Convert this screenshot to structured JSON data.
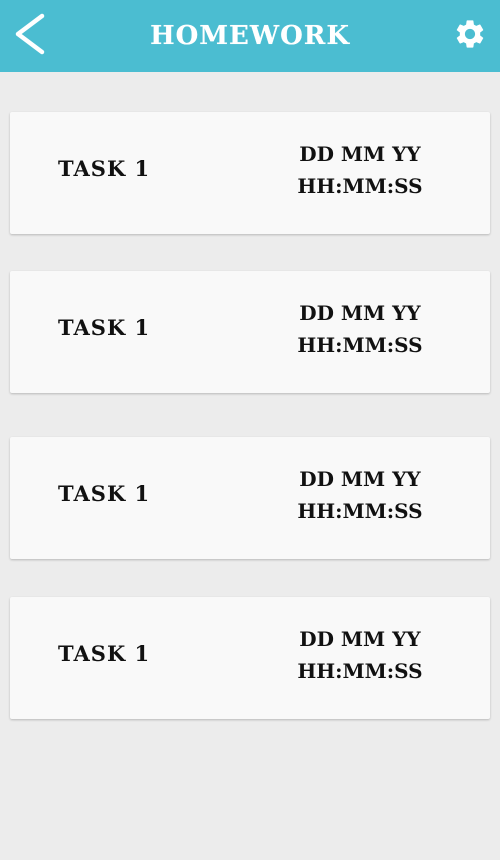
{
  "header": {
    "title": "HOMEWORK",
    "back_icon": "chevron-left-icon",
    "settings_icon": "gear-icon",
    "bar_color": "#4bbdd1"
  },
  "tasks": [
    {
      "name": "TASK 1",
      "date": "DD MM YY",
      "time": "HH:MM:SS"
    },
    {
      "name": "TASK 1",
      "date": "DD MM YY",
      "time": "HH:MM:SS"
    },
    {
      "name": "TASK 1",
      "date": "DD MM YY",
      "time": "HH:MM:SS"
    },
    {
      "name": "TASK 1",
      "date": "DD MM YY",
      "time": "HH:MM:SS"
    }
  ]
}
